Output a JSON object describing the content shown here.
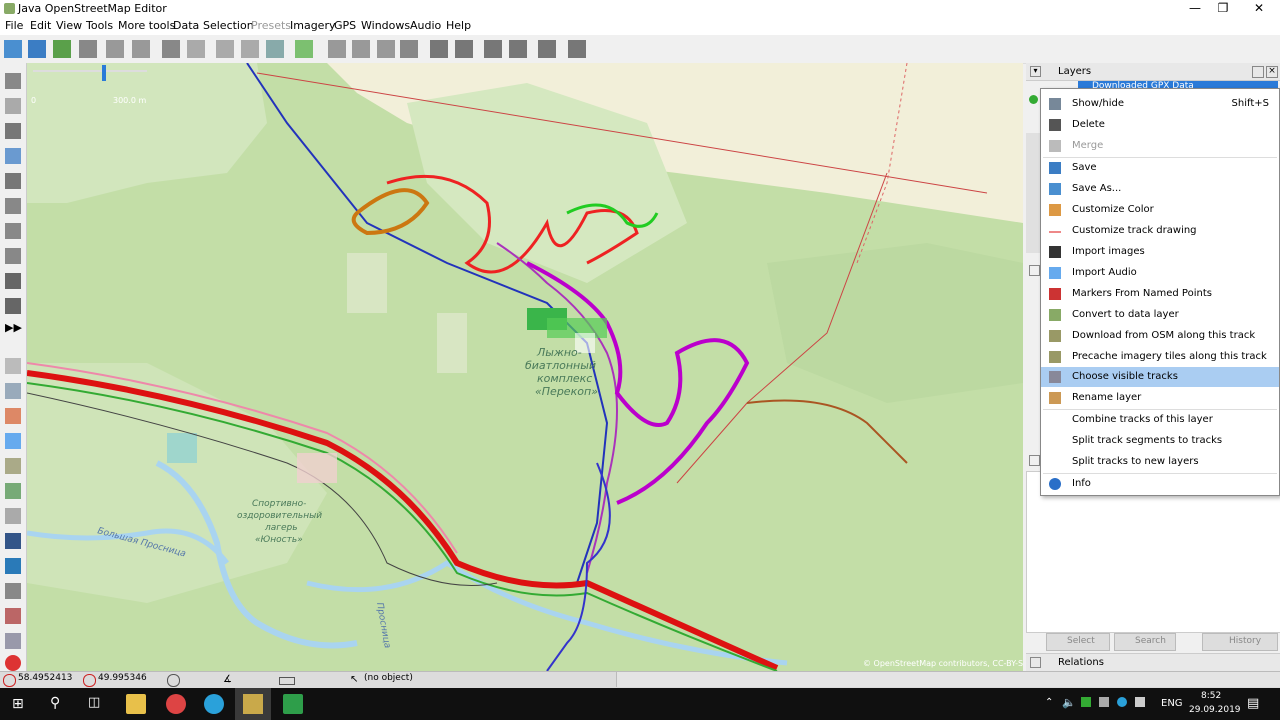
{
  "window": {
    "title": "Java OpenStreetMap Editor"
  },
  "menubar": [
    "File",
    "Edit",
    "View",
    "Tools",
    "More tools",
    "Data",
    "Selection",
    "Presets",
    "Imagery",
    "GPS",
    "Windows",
    "Audio",
    "Help"
  ],
  "map": {
    "scale_label": "300.0 m",
    "scale_zero": "0",
    "labels": {
      "ski_complex_1": "Лыжно-",
      "ski_complex_2": "биатлонный",
      "ski_complex_3": "комплекс",
      "ski_complex_4": "«Перекоп»",
      "camp_1": "Спортивно-",
      "camp_2": "оздоровительный",
      "camp_3": "лагерь",
      "camp_4": "«Юность»",
      "river": "Большая Просница",
      "river2": "Просница"
    },
    "attribution": "© OpenStreetMap contributors, CC-BY-SA"
  },
  "layers_panel": {
    "title": "Layers",
    "selected_layer": "Downloaded GPX Data",
    "relations_title": "Relations",
    "buttons": {
      "select": "Select",
      "search": "Search",
      "history": "History"
    }
  },
  "context_menu": {
    "items": [
      {
        "label": "Show/hide",
        "shortcut": "Shift+S"
      },
      {
        "label": "Delete"
      },
      {
        "label": "Merge"
      },
      {
        "label": "Save"
      },
      {
        "label": "Save As..."
      },
      {
        "label": "Customize Color"
      },
      {
        "label": "Customize track drawing"
      },
      {
        "label": "Import images"
      },
      {
        "label": "Import Audio"
      },
      {
        "label": "Markers From Named Points"
      },
      {
        "label": "Convert to data layer"
      },
      {
        "label": "Download from OSM along this track"
      },
      {
        "label": "Precache imagery tiles along this track"
      },
      {
        "label": "Choose visible tracks"
      },
      {
        "label": "Rename layer"
      },
      {
        "label": "Combine tracks of this layer"
      },
      {
        "label": "Split track segments to tracks"
      },
      {
        "label": "Split tracks to new layers"
      },
      {
        "label": "Info"
      }
    ]
  },
  "statusbar": {
    "lat": "58.4952413",
    "lon": "49.995346",
    "object": "(no object)"
  },
  "taskbar": {
    "lang": "ENG",
    "time": "8:52",
    "date": "29.09.2019"
  }
}
